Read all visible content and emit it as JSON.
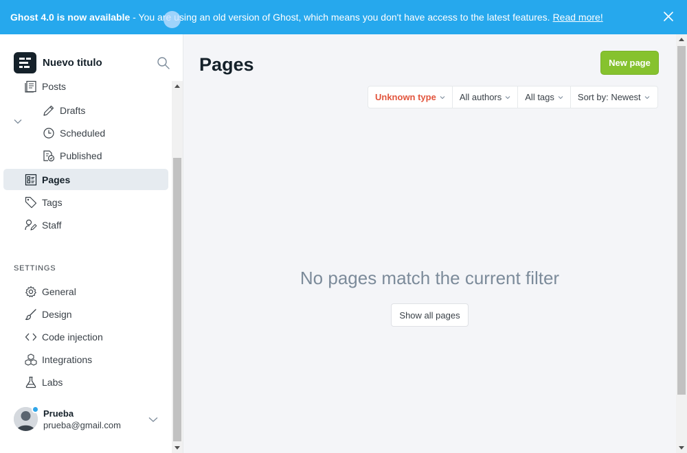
{
  "banner": {
    "headline": "Ghost 4.0 is now available",
    "message": " - You are using an old version of Ghost, which means you don't have access to the latest features.",
    "link": "Read more!",
    "close_icon": "close-icon"
  },
  "sidebar": {
    "site_title": "Nuevo titulo",
    "nav": [
      {
        "label": "Posts",
        "icon": "posts-icon"
      },
      {
        "label": "Drafts",
        "icon": "pencil-icon"
      },
      {
        "label": "Scheduled",
        "icon": "clock-icon"
      },
      {
        "label": "Published",
        "icon": "published-icon"
      },
      {
        "label": "Pages",
        "icon": "pages-icon",
        "active": true
      },
      {
        "label": "Tags",
        "icon": "tag-icon"
      },
      {
        "label": "Staff",
        "icon": "staff-icon"
      }
    ],
    "settings_heading": "SETTINGS",
    "settings": [
      {
        "label": "General",
        "icon": "gear-icon"
      },
      {
        "label": "Design",
        "icon": "brush-icon"
      },
      {
        "label": "Code injection",
        "icon": "code-icon"
      },
      {
        "label": "Integrations",
        "icon": "integrations-icon"
      },
      {
        "label": "Labs",
        "icon": "flask-icon"
      }
    ],
    "user": {
      "name": "Prueba",
      "email": "prueba@gmail.com"
    }
  },
  "main": {
    "title": "Pages",
    "new_button": "New page",
    "filters": [
      "Unknown type",
      "All authors",
      "All tags",
      "Sort by: Newest"
    ],
    "empty_message": "No pages match the current filter",
    "show_all": "Show all pages"
  },
  "colors": {
    "banner": "#26a8ed",
    "accent_green": "#86c22e",
    "warning_red": "#e2553d",
    "sidebar_active": "#e6ebf0"
  }
}
